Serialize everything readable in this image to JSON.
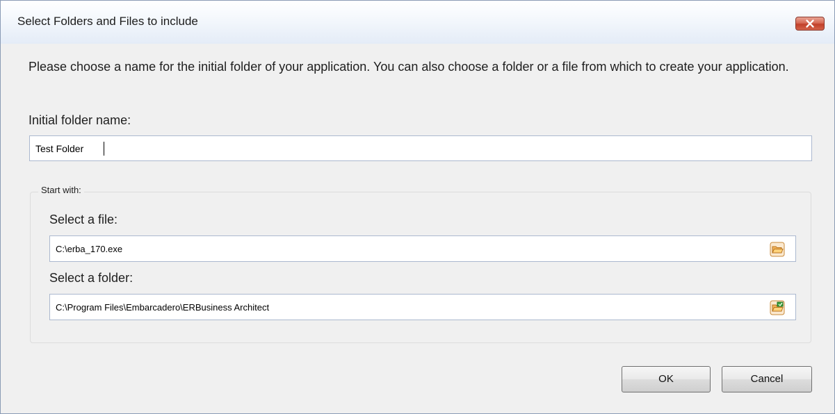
{
  "window": {
    "title": "Select Folders and Files to include"
  },
  "dialog": {
    "instructions": "Please choose a name for the initial folder of your application. You can also choose a folder or a file from which to create your application.",
    "initial_folder_label": "Initial folder name:",
    "initial_folder_value": "Test Folder",
    "start_with_label": "Start with:",
    "select_file_label": "Select a file:",
    "select_file_value": "C:\\erba_170.exe",
    "select_folder_label": "Select a folder:",
    "select_folder_value": "C:\\Program Files\\Embarcadero\\ERBusiness Architect",
    "ok_label": "OK",
    "cancel_accesskey": "C",
    "cancel_rest": "ancel"
  },
  "icons": {
    "close": "close-icon",
    "browse_file": "open-file-icon",
    "browse_folder": "browse-folder-icon"
  },
  "colors": {
    "close_button": "#d4624a",
    "browse_file_icon": "#e8a040",
    "browse_folder_icon": "#3aa33a"
  }
}
